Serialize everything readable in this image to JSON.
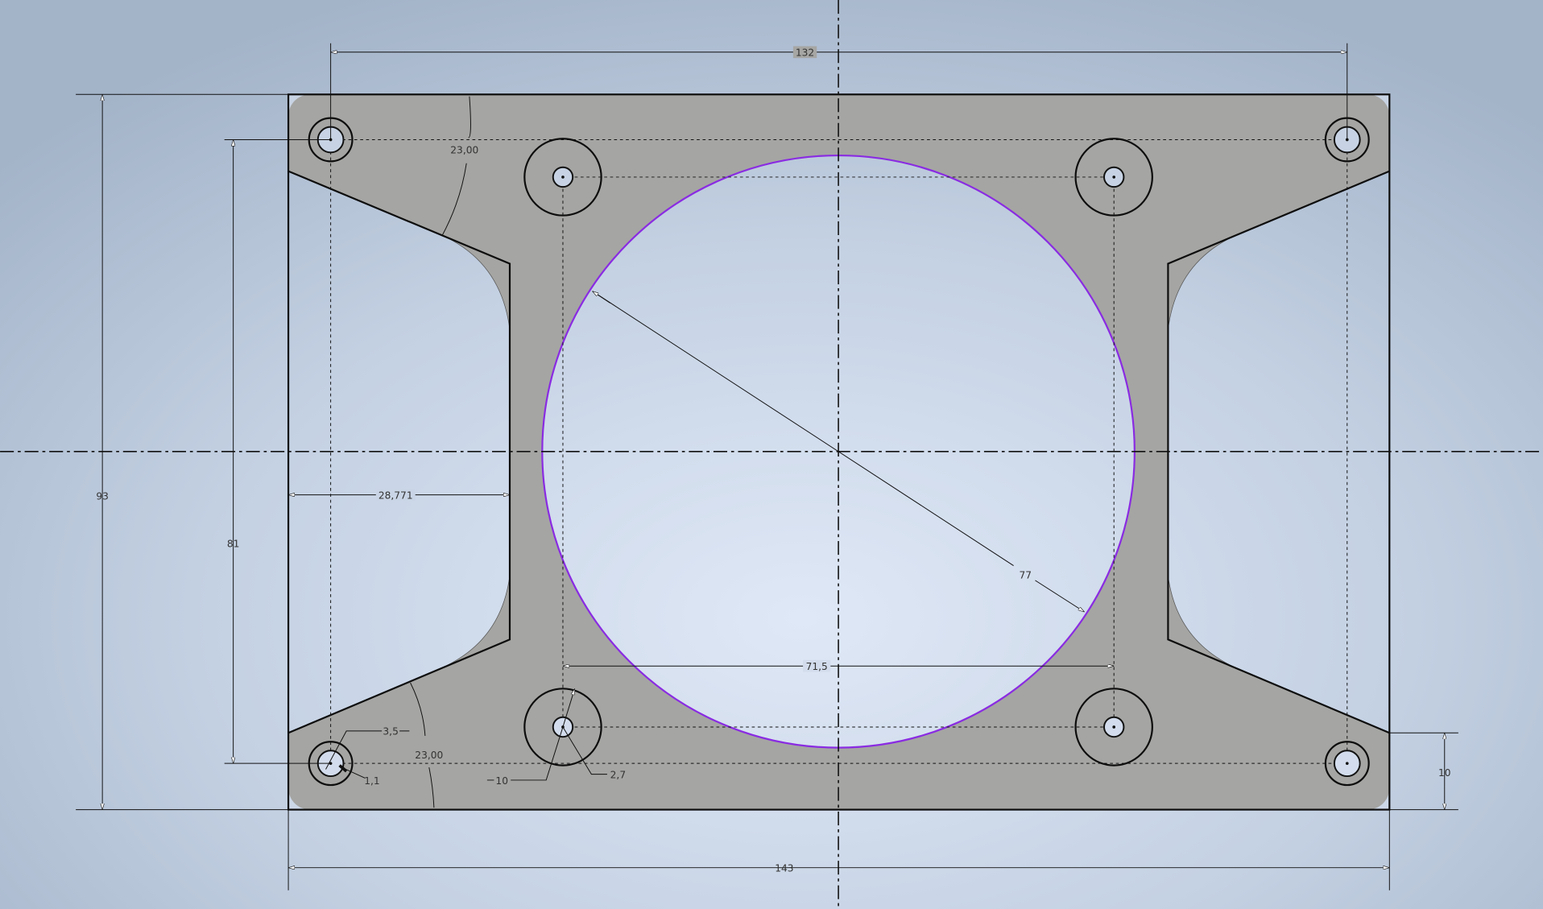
{
  "sketch": {
    "plate_fill": "#a5a5a3",
    "circle_color": "#8a2be2",
    "dimensions": {
      "overall_width": "143",
      "hole_spacing_x": "132",
      "overall_height": "93",
      "hole_spacing_y": "81",
      "cutout_depth": "28,771",
      "inner_hole_spacing": "71,5",
      "big_circle_diameter": "77",
      "bottom_offset": "10",
      "angle_top": "23,00",
      "angle_bottom": "23,00",
      "corner_hole_diameter": "3,5",
      "corner_hole_chamfer": "1,1",
      "boss_diameter": "10",
      "boss_hole_diameter": "2,7"
    }
  }
}
